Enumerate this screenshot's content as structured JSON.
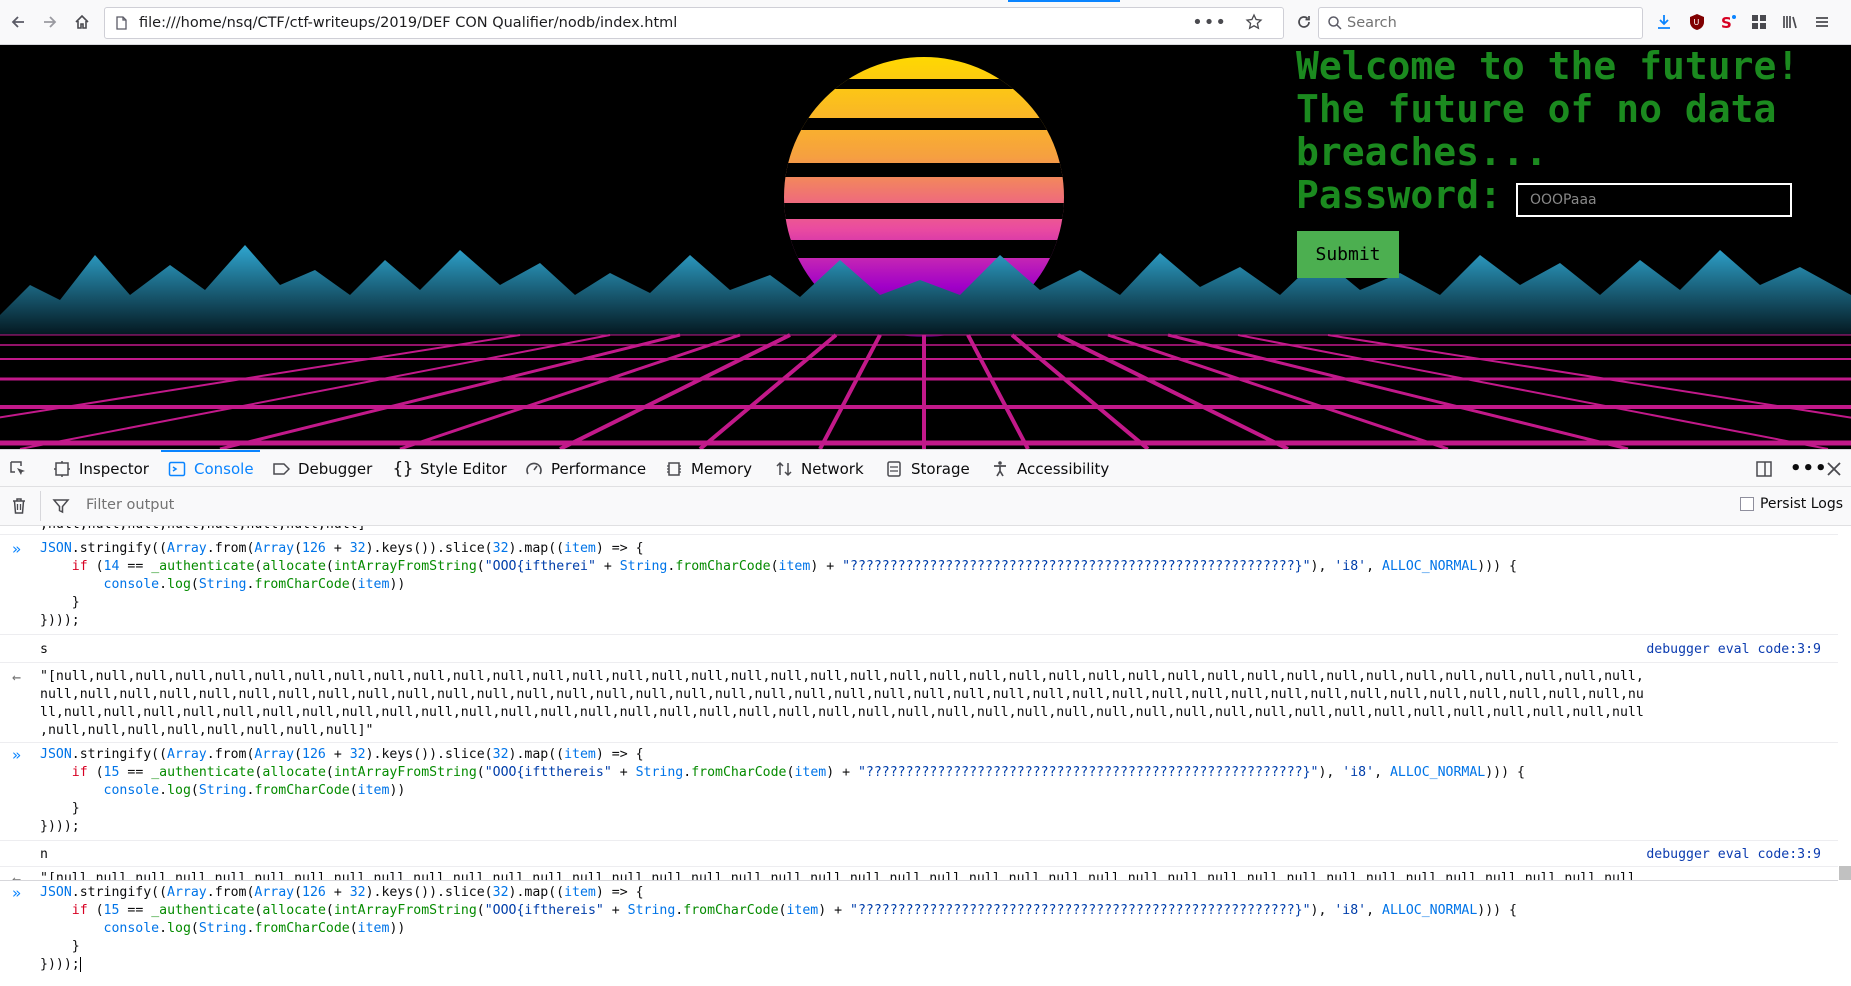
{
  "browser": {
    "url": "file:///home/nsq/CTF/ctf-writeups/2019/DEF CON Qualifier/nodb/index.html",
    "url_more": "•••",
    "search_placeholder": "Search"
  },
  "page": {
    "heading_lines": [
      "Welcome to the future!",
      "The future of no data",
      "breaches...",
      "Password:"
    ],
    "password_value": "OOOPaaa",
    "submit_label": "Submit"
  },
  "devtools": {
    "tabs": [
      {
        "label": "Inspector",
        "icon": "inspector-icon"
      },
      {
        "label": "Console",
        "icon": "console-icon",
        "active": true
      },
      {
        "label": "Debugger",
        "icon": "debugger-icon"
      },
      {
        "label": "Style Editor",
        "icon": "style-editor-icon"
      },
      {
        "label": "Performance",
        "icon": "performance-icon"
      },
      {
        "label": "Memory",
        "icon": "memory-icon"
      },
      {
        "label": "Network",
        "icon": "network-icon"
      },
      {
        "label": "Storage",
        "icon": "storage-icon"
      },
      {
        "label": "Accessibility",
        "icon": "accessibility-icon"
      }
    ],
    "filter_placeholder": "Filter output",
    "persist_logs_label": "Persist Logs"
  },
  "console": {
    "top_fragment": ",null,null,null,null,null,null,null,null]",
    "entries": [
      {
        "input_lines": [
          "JSON.stringify((Array.from(Array(126 + 32).keys()).slice(32).map((item) => {",
          "    if (14 == _authenticate(allocate(intArrayFromString(\"OOO{iftherei\" + String.fromCharCode(item) + \"????????????????????????????????????????????????????????}\"), 'i8', ALLOC_NORMAL))) {",
          "        console.log(String.fromCharCode(item))",
          "    }",
          "})));"
        ],
        "log": "s",
        "location": "debugger eval code:3:9",
        "result_lines": [
          "\"[null,null,null,null,null,null,null,null,null,null,null,null,null,null,null,null,null,null,null,null,null,null,null,null,null,null,null,null,null,null,null,null,null,null,null,null,null,null,null,null,",
          "null,null,null,null,null,null,null,null,null,null,null,null,null,null,null,null,null,null,null,null,null,null,null,null,null,null,null,null,null,null,null,null,null,null,null,null,null,null,null,null,nu",
          "ll,null,null,null,null,null,null,null,null,null,null,null,null,null,null,null,null,null,null,null,null,null,null,null,null,null,null,null,null,null,null,null,null,null,null,null,null,null,null,null,null",
          ",null,null,null,null,null,null,null,null]\""
        ]
      },
      {
        "input_lines": [
          "JSON.stringify((Array.from(Array(126 + 32).keys()).slice(32).map((item) => {",
          "    if (15 == _authenticate(allocate(intArrayFromString(\"OOO{iftthereis\" + String.fromCharCode(item) + \"???????????????????????????????????????????????????????}\"), 'i8', ALLOC_NORMAL))) {",
          "        console.log(String.fromCharCode(item))",
          "    }",
          "})));"
        ],
        "log": "n",
        "location": "debugger eval code:3:9",
        "result_lines": [
          "\"[null,null,null,null,null,null,null,null,null,null,null,null,null,null,null,null,null,null,null,null,null,null,null,null,null,null,null,null,null,null,null,null,null,null,null,null,null,null,null,null,"
        ]
      }
    ],
    "current_input_lines": [
      "JSON.stringify((Array.from(Array(126 + 32).keys()).slice(32).map((item) => {",
      "    if (15 == _authenticate(allocate(intArrayFromString(\"OOO{ifthereis\" + String.fromCharCode(item) + \"???????????????????????????????????????????????????????}\"), 'i8', ALLOC_NORMAL))) {",
      "        console.log(String.fromCharCode(item))",
      "    }",
      "})));"
    ]
  },
  "colors": {
    "heading_green": "#1b8a1f",
    "submit_green": "#4caf50",
    "devtools_accent": "#0a84ff"
  }
}
